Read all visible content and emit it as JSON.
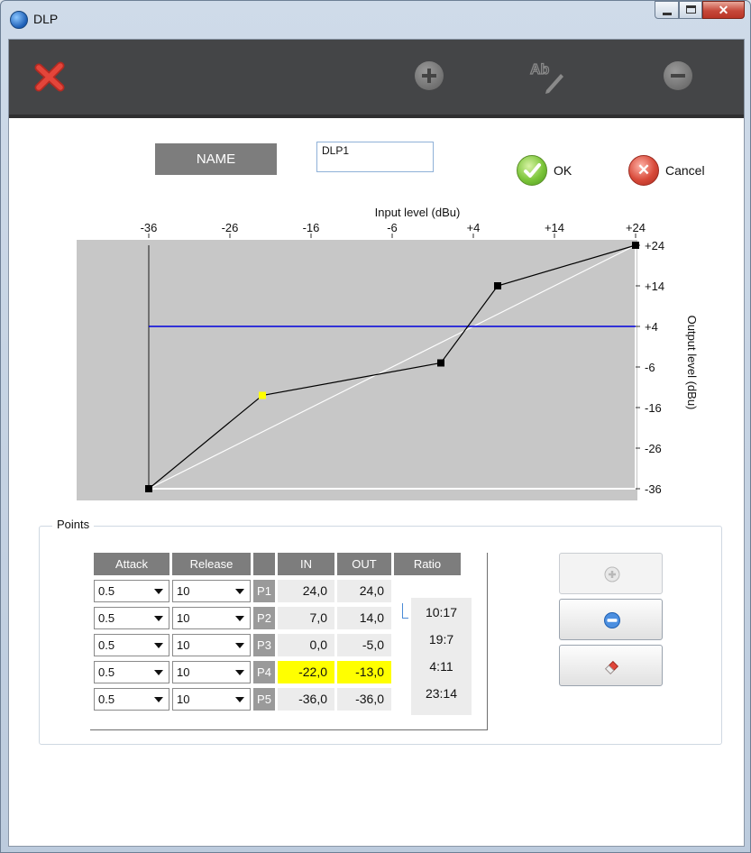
{
  "window": {
    "title": "DLP",
    "controls": [
      "minimize",
      "maximize",
      "close"
    ]
  },
  "toolbar": {
    "close_icon": "close-icon",
    "add_icon": "add-circle-icon",
    "rename_icon": "rename-icon",
    "rename_glyph": "Ab",
    "remove_icon": "remove-circle-icon"
  },
  "name": {
    "label": "NAME",
    "value": "DLP1"
  },
  "actions": {
    "ok_label": "OK",
    "cancel_label": "Cancel"
  },
  "chart_data": {
    "type": "line",
    "title": "",
    "xlabel": "Input level (dBu)",
    "ylabel": "Output level (dBu)",
    "x_ticks": [
      "-36",
      "-26",
      "-16",
      "-6",
      "+4",
      "+14",
      "+24"
    ],
    "y_ticks": [
      "+24",
      "+14",
      "+4",
      "-6",
      "-16",
      "-26",
      "-36"
    ],
    "xlim": [
      -36,
      24
    ],
    "ylim": [
      -36,
      24
    ],
    "series": [
      {
        "name": "",
        "color": "#000000",
        "points": [
          [
            -36,
            -36
          ],
          [
            -22,
            -13
          ],
          [
            0,
            -5
          ],
          [
            7,
            14
          ],
          [
            24,
            24
          ]
        ]
      },
      {
        "name": "",
        "color": "#ffffff",
        "points": [
          [
            -36,
            -36
          ],
          [
            24,
            24
          ]
        ]
      },
      {
        "name": "",
        "color": "#0000dd",
        "points": [
          [
            -36,
            4
          ],
          [
            24,
            4
          ]
        ]
      }
    ],
    "selected_point": [
      -22,
      -13
    ],
    "selected_color": "#ffff00"
  },
  "points": {
    "title": "Points",
    "columns": [
      "Attack",
      "Release",
      "",
      "IN",
      "OUT",
      "Ratio"
    ],
    "rows": [
      {
        "attack": "0.5",
        "release": "10",
        "label": "P1",
        "in": "24,0",
        "out": "24,0",
        "highlight": false
      },
      {
        "attack": "0.5",
        "release": "10",
        "label": "P2",
        "in": "7,0",
        "out": "14,0",
        "highlight": false
      },
      {
        "attack": "0.5",
        "release": "10",
        "label": "P3",
        "in": "0,0",
        "out": "-5,0",
        "highlight": false
      },
      {
        "attack": "0.5",
        "release": "10",
        "label": "P4",
        "in": "-22,0",
        "out": "-13,0",
        "highlight": true
      },
      {
        "attack": "0.5",
        "release": "10",
        "label": "P5",
        "in": "-36,0",
        "out": "-36,0",
        "highlight": false
      }
    ],
    "ratios": [
      "10:17",
      "19:7",
      "4:11",
      "23:14"
    ],
    "buttons": [
      {
        "icon": "add-circle-icon",
        "enabled": false
      },
      {
        "icon": "remove-circle-icon",
        "enabled": true
      },
      {
        "icon": "eraser-icon",
        "enabled": true
      }
    ]
  }
}
